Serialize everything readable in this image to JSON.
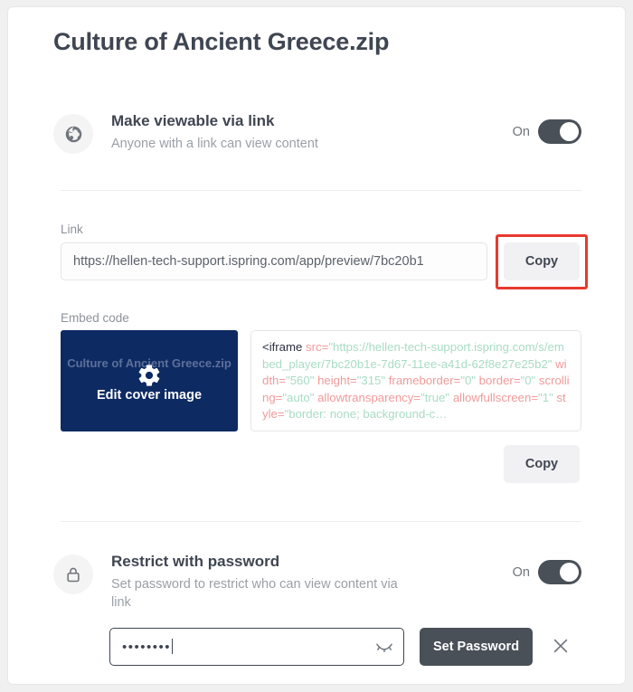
{
  "page": {
    "title": "Culture of Ancient Greece.zip"
  },
  "link_sharing": {
    "icon": "globe-icon",
    "title": "Make viewable via link",
    "subtitle": "Anyone with a link can view content",
    "toggle_label": "On",
    "toggle_state": "on"
  },
  "link_section": {
    "label": "Link",
    "value": "https://hellen-tech-support.ispring.com/app/preview/7bc20b1",
    "copy_label": "Copy"
  },
  "embed_section": {
    "label": "Embed code",
    "cover": {
      "title": "Culture of Ancient Greece.zip",
      "action_label": "Edit cover image",
      "icon": "gear-icon",
      "background": "#0e2a63"
    },
    "copy_label": "Copy",
    "code_tokens": [
      {
        "t": "tag",
        "v": "<iframe "
      },
      {
        "t": "attr",
        "v": "src"
      },
      {
        "t": "punct",
        "v": "="
      },
      {
        "t": "str",
        "v": "\"https://hellen-tech-support.ispring.com/s/embed_player/7bc20b1e-7d67-11ee-a41d-62f8e27e25b2\""
      },
      {
        "t": "attr",
        "v": " width"
      },
      {
        "t": "punct",
        "v": "="
      },
      {
        "t": "str",
        "v": "\"560\""
      },
      {
        "t": "attr",
        "v": " height"
      },
      {
        "t": "punct",
        "v": "="
      },
      {
        "t": "str",
        "v": "\"315\""
      },
      {
        "t": "attr",
        "v": " frameborder"
      },
      {
        "t": "punct",
        "v": "="
      },
      {
        "t": "str",
        "v": "\"0\""
      },
      {
        "t": "attr",
        "v": " border"
      },
      {
        "t": "punct",
        "v": "="
      },
      {
        "t": "str",
        "v": "\"0\""
      },
      {
        "t": "attr",
        "v": " scrolling"
      },
      {
        "t": "punct",
        "v": "="
      },
      {
        "t": "str",
        "v": "\"auto\""
      },
      {
        "t": "attr",
        "v": " allowtransparency"
      },
      {
        "t": "punct",
        "v": "="
      },
      {
        "t": "str",
        "v": "\"true\""
      },
      {
        "t": "attr",
        "v": " allowfullscreen"
      },
      {
        "t": "punct",
        "v": "="
      },
      {
        "t": "str",
        "v": "\"1\""
      },
      {
        "t": "attr",
        "v": " style"
      },
      {
        "t": "punct",
        "v": "="
      },
      {
        "t": "str",
        "v": "\"border: none; background-c…"
      }
    ]
  },
  "password_section": {
    "icon": "lock-icon",
    "title": "Restrict with password",
    "subtitle": "Set password to restrict who can view content via link",
    "toggle_label": "On",
    "toggle_state": "on",
    "password_value": "••••••••",
    "password_visibility_icon": "eye-off-icon",
    "submit_label": "Set Password",
    "close_icon": "close-icon"
  },
  "annotation": {
    "target": "link-copy-button",
    "color": "#e8392e"
  }
}
